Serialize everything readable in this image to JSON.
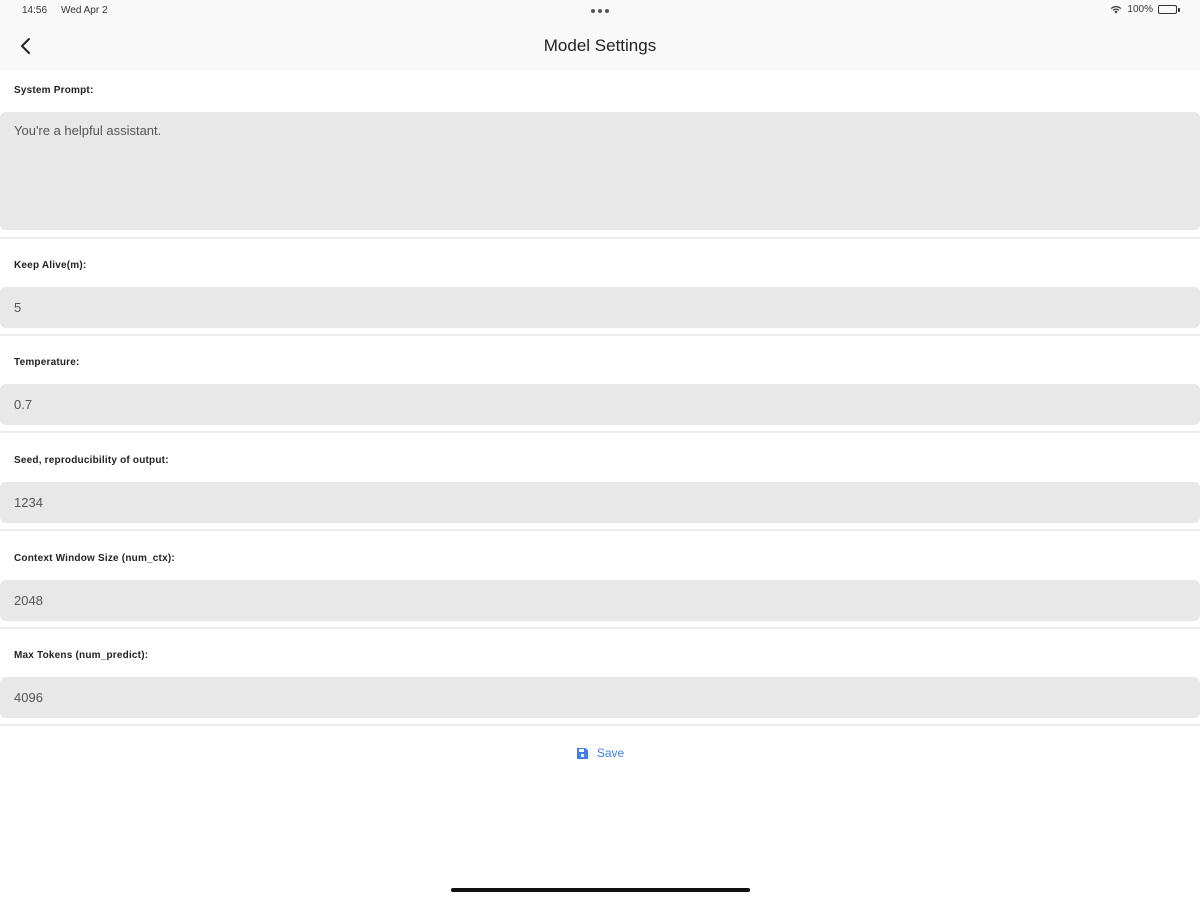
{
  "status_bar": {
    "time": "14:56",
    "date": "Wed Apr 2",
    "battery_text": "100%",
    "battery_level": 1.0
  },
  "nav": {
    "title": "Model Settings",
    "back_icon": "chevron-left-icon"
  },
  "fields": {
    "system_prompt": {
      "label": "System Prompt:",
      "value": "You're a helpful assistant."
    },
    "keep_alive": {
      "label": "Keep Alive(m):",
      "value": "5"
    },
    "temperature": {
      "label": "Temperature:",
      "value": "0.7"
    },
    "seed": {
      "label": "Seed, reproducibility of output:",
      "value": "1234"
    },
    "num_ctx": {
      "label": "Context Window Size (num_ctx):",
      "value": "2048"
    },
    "num_predict": {
      "label": "Max Tokens (num_predict):",
      "value": "4096"
    }
  },
  "save": {
    "label": "Save",
    "icon": "floppy-disk-icon",
    "color": "#3d7fe6"
  }
}
